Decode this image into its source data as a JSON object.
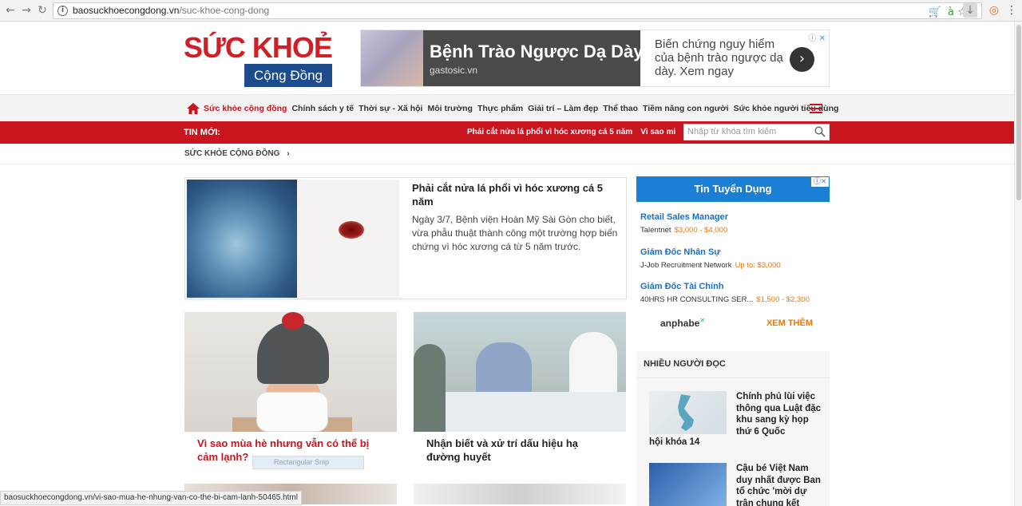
{
  "browser": {
    "url_host": "baosuckhoecongdong.vn",
    "url_path": "/suc-khoe-cong-dong",
    "status_url": "baosuckhoecongdong.vn/vi-sao-mua-he-nhung-van-co-the-bi-cam-lanh-50465.html"
  },
  "header": {
    "logo_main": "SỨC KHOẺ",
    "logo_sub": "Cộng Đồng"
  },
  "top_ad": {
    "title": "Bệnh Trào Ngược Dạ Dày",
    "domain": "gastosic.vn",
    "description": "Biến chứng nguy hiểm của bệnh trào ngược dạ dày. Xem ngay",
    "arrow": "›",
    "badge": "ⓘ ✕"
  },
  "nav": {
    "items": [
      "Sức khỏe cộng đồng",
      "Chính sách y tế",
      "Thời sự - Xã hội",
      "Môi trường",
      "Thực phẩm",
      "Giải trí – Làm đẹp",
      "Thể thao",
      "Tiềm năng con người",
      "Sức khỏe người tiêu dùng"
    ]
  },
  "news_bar": {
    "label": "TIN MỚI:",
    "ticker_1": "Phải cắt nửa lá phổi vì hóc xương cá 5 năm",
    "ticker_2": "Vì sao mi",
    "search_placeholder": "Nhập từ khóa tìm kiếm"
  },
  "breadcrumb": {
    "label": "SỨC KHỎE CỘNG ĐỒNG",
    "arrow": "›"
  },
  "featured": {
    "title": "Phải cắt nửa lá phổi vì hóc xương cá 5 năm",
    "description": "Ngày 3/7, Bệnh viện Hoàn Mỹ Sài Gòn cho biết, vừa phẫu thuật thành công một trường hợp biến chứng vì hóc xương cá từ 5 năm trước."
  },
  "cards": [
    {
      "title": "Vì sao mùa hè nhưng vẫn có thể bị cảm lạnh?",
      "color": "#c8141c"
    },
    {
      "title": "Nhận biết và xử trí dấu hiệu hạ đường huyết",
      "color": "#222222"
    }
  ],
  "snip_label": "Rectangular Snip",
  "jobs": {
    "header": "Tin Tuyển Dụng",
    "badge": "ⓘ✕",
    "items": [
      {
        "title": "Retail Sales Manager",
        "company": "Talentnet",
        "salary": "$3,000 - $4,000"
      },
      {
        "title": "Giám Đốc Nhân Sự",
        "company": "J-Job Recruitment Network",
        "salary": "Up to: $3,000"
      },
      {
        "title": "Giám Đốc Tài Chính",
        "company": "40HRS HR CONSULTING SER...",
        "salary": "$1,500 - $2,300"
      }
    ],
    "brand": "anphabe",
    "more_label": "XEM THÊM"
  },
  "most_read": {
    "header": "NHIỀU NGƯỜI ĐỌC",
    "items": [
      {
        "text": "Chính phủ lùi việc thông qua Luật đặc khu sang kỳ họp thứ 6 Quốc",
        "extra": "hội khóa 14"
      },
      {
        "text": "Cậu bé Việt Nam duy nhất được Ban tổ chức 'mời dự trận chung kết",
        "extra": ""
      }
    ]
  },
  "colors": {
    "brand_red": "#c8141c",
    "brand_blue": "#1c4c8c",
    "jobs_blue": "#1c7fd6",
    "salary_orange": "#e8780c"
  }
}
